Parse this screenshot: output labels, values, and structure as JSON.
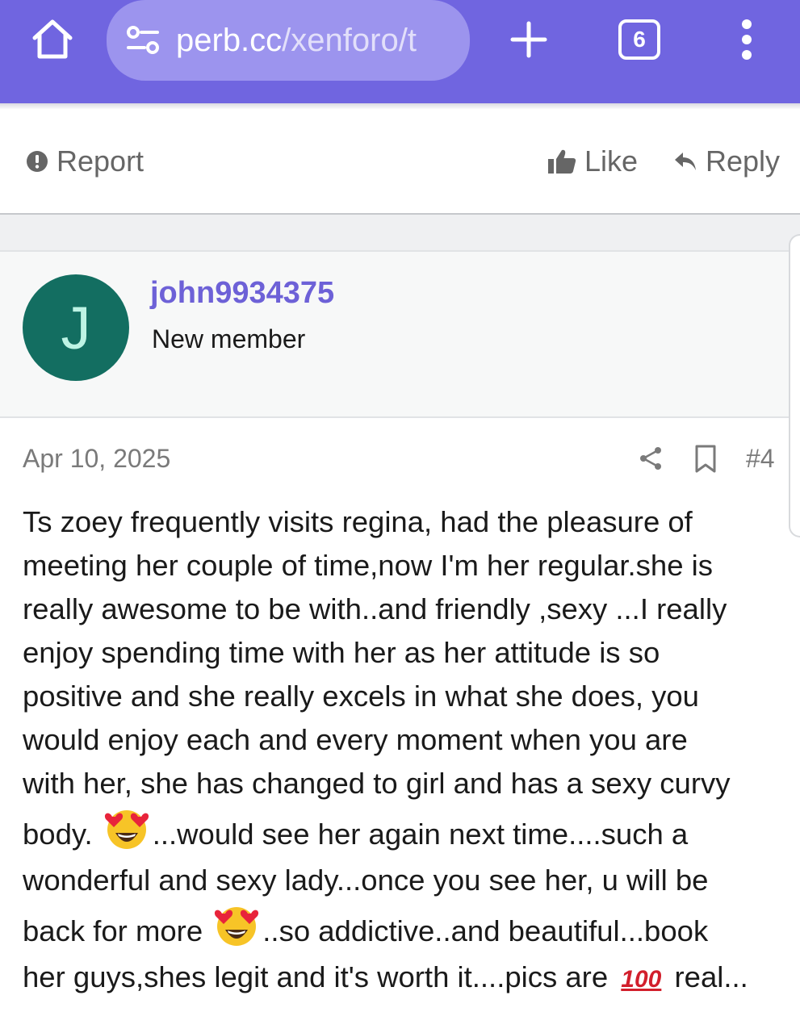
{
  "browser": {
    "url_host": "perb.cc",
    "url_path": "/xenforo/t",
    "tab_count": "6"
  },
  "actions": {
    "report": "Report",
    "like": "Like",
    "reply": "Reply"
  },
  "post": {
    "avatar_letter": "J",
    "username": "john9934375",
    "user_title": "New member",
    "date": "Apr 10, 2025",
    "number": "#4",
    "lines": [
      "Ts zoey frequently visits regina, had the pleasure of",
      "meeting her couple of time,now I'm her regular.she is",
      "really awesome to be with..and friendly ,sexy ...I really",
      "enjoy spending time with her as her attitude is so",
      "positive and she really excels in what she does, you",
      "would enjoy each and every moment when you are",
      "with her, she has changed to girl and has a sexy curvy"
    ],
    "line8_a": "body. ",
    "line8_b": "...would see her again next time....such a",
    "line9": "wonderful and sexy lady...once you see her, u will be",
    "line10_a": "back for more ",
    "line10_b": "..so addictive..and beautiful...book",
    "line11_a": "her guys,shes legit and it's worth it....pics are ",
    "line11_emoji": "100",
    "line11_b": " real..."
  },
  "icons": {
    "home": "home-icon",
    "site_info": "site-settings-icon",
    "new_tab": "plus-icon",
    "tabs": "tab-count-icon",
    "menu": "more-vert-icon",
    "report": "alert-circle-icon",
    "like": "thumbs-up-icon",
    "reply": "reply-arrow-icon",
    "share": "share-icon",
    "bookmark": "bookmark-icon",
    "emoji_heart_eyes": "heart-eyes-emoji",
    "emoji_100": "hundred-points-emoji"
  },
  "colors": {
    "browser_bar": "#7065e0",
    "url_pill": "#9c94ee",
    "username": "#6d61d7",
    "avatar_bg": "#136e61",
    "avatar_text": "#bdf3e4"
  }
}
